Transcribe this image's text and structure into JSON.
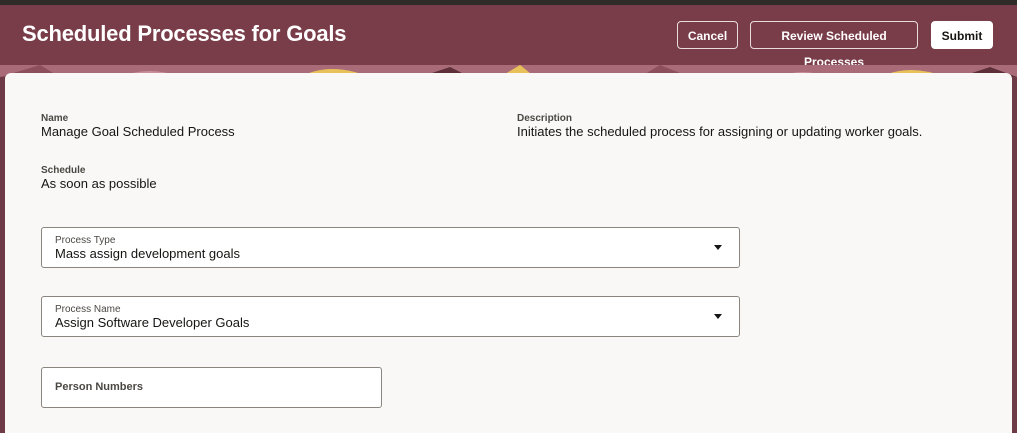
{
  "header": {
    "title": "Scheduled Processes for Goals",
    "cancel_label": "Cancel",
    "review_label": "Review Scheduled Processes",
    "submit_label": "Submit"
  },
  "details": {
    "name_label": "Name",
    "name_value": "Manage Goal Scheduled Process",
    "description_label": "Description",
    "description_value": "Initiates the scheduled process for assigning or updating worker goals.",
    "schedule_label": "Schedule",
    "schedule_value": "As soon as possible"
  },
  "form": {
    "process_type_label": "Process Type",
    "process_type_value": "Mass assign development goals",
    "process_name_label": "Process Name",
    "process_name_value": "Assign Software Developer Goals",
    "person_numbers_placeholder": "Person Numbers"
  },
  "colors": {
    "header_bg": "#793d4a",
    "panel_bg": "#f9f8f6",
    "pattern_accent": "#e8c15a"
  },
  "icons": [
    "chevron-down-icon"
  ]
}
